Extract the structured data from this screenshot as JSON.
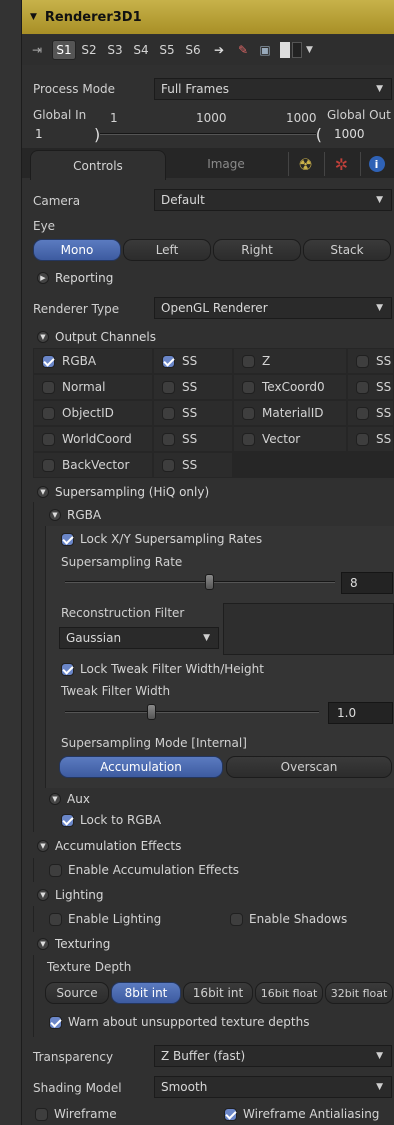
{
  "title": "Renderer3D1",
  "toolbar": {
    "slots": [
      "S1",
      "S2",
      "S3",
      "S4",
      "S5",
      "S6"
    ]
  },
  "process_mode": {
    "label": "Process Mode",
    "value": "Full Frames"
  },
  "range": {
    "global_in_label": "Global In",
    "global_in_value": "1",
    "range_start": "1",
    "range_mid": "1000",
    "range_end": "1000",
    "global_out_label": "Global Out",
    "global_out_value": "1000"
  },
  "tabs": {
    "controls": "Controls",
    "image": "Image"
  },
  "camera": {
    "label": "Camera",
    "value": "Default"
  },
  "eye": {
    "label": "Eye",
    "options": [
      "Mono",
      "Left",
      "Right",
      "Stack"
    ]
  },
  "reporting": "Reporting",
  "renderer_type": {
    "label": "Renderer Type",
    "value": "OpenGL Renderer"
  },
  "output_channels": {
    "header": "Output Channels",
    "rows": [
      [
        "RGBA",
        "SS",
        "Z",
        "SS"
      ],
      [
        "Normal",
        "SS",
        "TexCoord0",
        "SS"
      ],
      [
        "ObjectID",
        "SS",
        "MaterialID",
        "SS"
      ],
      [
        "WorldCoord",
        "SS",
        "Vector",
        "SS"
      ],
      [
        "BackVector",
        "SS"
      ]
    ]
  },
  "supersampling": {
    "header": "Supersampling (HiQ only)",
    "rgba": "RGBA",
    "lock_rates": "Lock X/Y Supersampling Rates",
    "rate_label": "Supersampling Rate",
    "rate_value": "8",
    "rate_fraction": 0.5,
    "recon_label": "Reconstruction Filter",
    "recon_value": "Gaussian",
    "lock_tweak": "Lock Tweak Filter Width/Height",
    "tweak_label": "Tweak Filter Width",
    "tweak_value": "1.0",
    "tweak_fraction": 0.33,
    "mode_label": "Supersampling Mode [Internal]",
    "mode_options": [
      "Accumulation",
      "Overscan"
    ],
    "aux": "Aux",
    "lock_rgba": "Lock to RGBA"
  },
  "accumulation": {
    "header": "Accumulation Effects",
    "enable": "Enable Accumulation Effects"
  },
  "lighting": {
    "header": "Lighting",
    "enable_lighting": "Enable Lighting",
    "enable_shadows": "Enable Shadows"
  },
  "texturing": {
    "header": "Texturing",
    "depth_label": "Texture Depth",
    "depth_options": [
      "Source",
      "8bit int",
      "16bit int",
      "16bit float",
      "32bit float"
    ],
    "warn": "Warn about unsupported texture depths"
  },
  "transparency": {
    "label": "Transparency",
    "value": "Z Buffer (fast)"
  },
  "shading": {
    "label": "Shading Model",
    "value": "Smooth"
  },
  "wireframe": {
    "wireframe": "Wireframe",
    "antialiasing": "Wireframe Antialiasing"
  },
  "colors": {
    "title_bar": "#b89f35",
    "accent": "#4d6cb0",
    "panel": "#303030"
  }
}
